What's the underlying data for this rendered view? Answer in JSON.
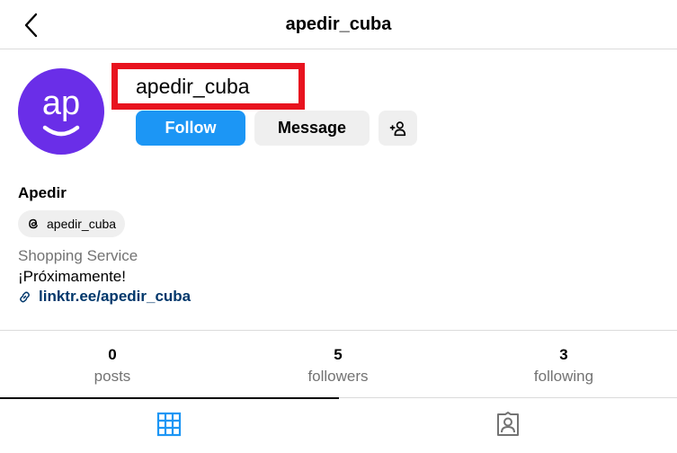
{
  "header": {
    "title": "apedir_cuba"
  },
  "profile": {
    "avatar_text": "ap",
    "username": "apedir_cuba",
    "full_name": "Apedir",
    "threads_handle": "apedir_cuba",
    "category": "Shopping Service",
    "bio": "¡Próximamente!",
    "link": "linktr.ee/apedir_cuba"
  },
  "actions": {
    "follow": "Follow",
    "message": "Message"
  },
  "stats": [
    {
      "value": "0",
      "label": "posts"
    },
    {
      "value": "5",
      "label": "followers"
    },
    {
      "value": "3",
      "label": "following"
    }
  ],
  "colors": {
    "accent": "#1c96f5",
    "avatar_bg": "#6a2ee8",
    "highlight_box": "#e8131f",
    "link": "#00376b"
  }
}
